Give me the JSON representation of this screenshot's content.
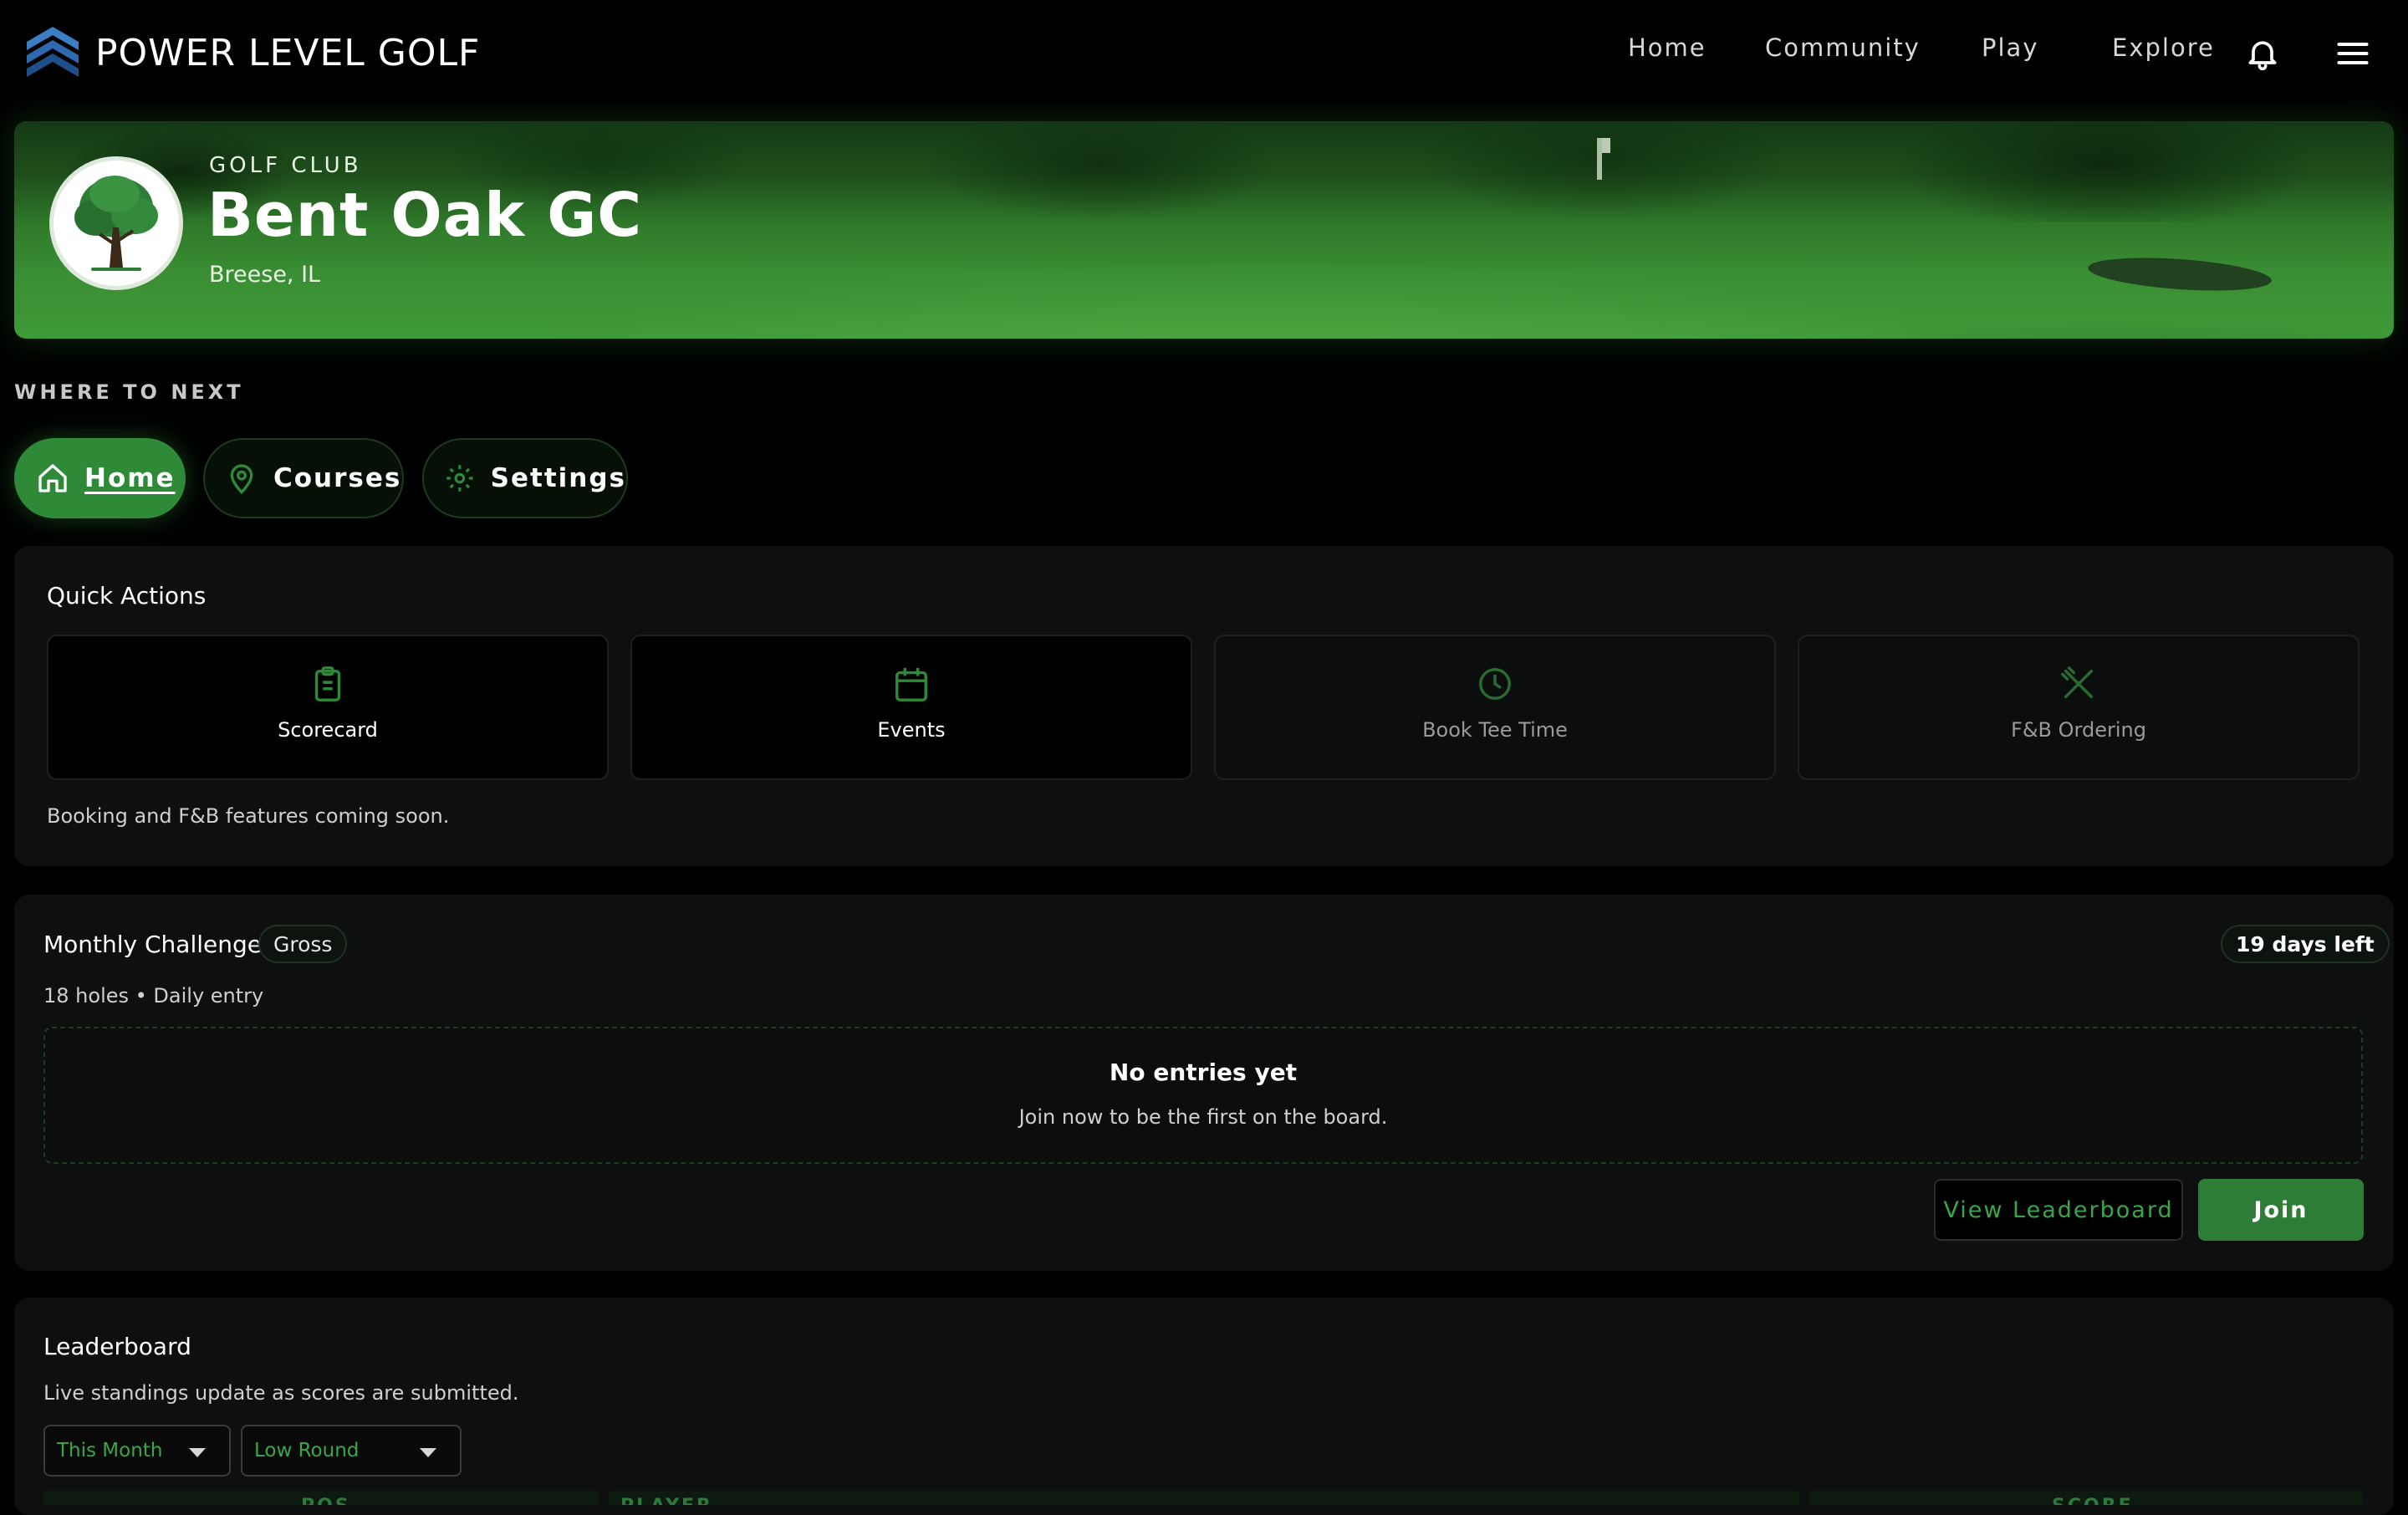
{
  "brand": {
    "name": "POWER LEVEL GOLF",
    "logo_icon": "layered-chevron-icon"
  },
  "nav": {
    "links": [
      "Home",
      "Community",
      "Play",
      "Explore"
    ],
    "notification_icon": "bell-icon",
    "menu_icon": "hamburger-menu-icon"
  },
  "hero": {
    "kicker": "GOLF CLUB",
    "name": "Bent Oak GC",
    "location": "Breese, IL",
    "badge_icon": "oak-tree-icon"
  },
  "where_next": {
    "kicker": "WHERE TO NEXT",
    "tabs": [
      {
        "label": "Home",
        "icon": "house-icon",
        "active": true
      },
      {
        "label": "Courses",
        "icon": "map-pin-icon",
        "active": false
      },
      {
        "label": "Settings",
        "icon": "gear-icon",
        "active": false
      }
    ]
  },
  "quick_actions": {
    "title": "Quick Actions",
    "tiles": [
      {
        "label": "Scorecard",
        "icon": "clipboard-icon",
        "enabled": true
      },
      {
        "label": "Events",
        "icon": "calendar-icon",
        "enabled": true
      },
      {
        "label": "Book Tee Time",
        "icon": "clock-icon",
        "enabled": false
      },
      {
        "label": "F&B Ordering",
        "icon": "utensils-icon",
        "enabled": false
      }
    ],
    "note": "Booking and F&B features coming soon."
  },
  "monthly_challenge": {
    "title": "Monthly Challenge",
    "format_badge": "Gross",
    "days_left": "19 days left",
    "meta": "18 holes • Daily entry",
    "empty_title": "No entries yet",
    "empty_sub": "Join now to be the first on the board.",
    "view_leaderboard_label": "View Leaderboard",
    "join_label": "Join"
  },
  "leaderboard": {
    "title": "Leaderboard",
    "subtitle": "Live standings update as scores are submitted.",
    "period_select": "This Month",
    "metric_select": "Low Round",
    "columns": [
      "POS",
      "PLAYER",
      "SCORE"
    ]
  },
  "colors": {
    "accent_green": "#2e8a37",
    "button_green": "#2e7d36",
    "link_green": "#3aa64a",
    "card_bg": "#0e0f0f",
    "page_bg": "#000000"
  }
}
